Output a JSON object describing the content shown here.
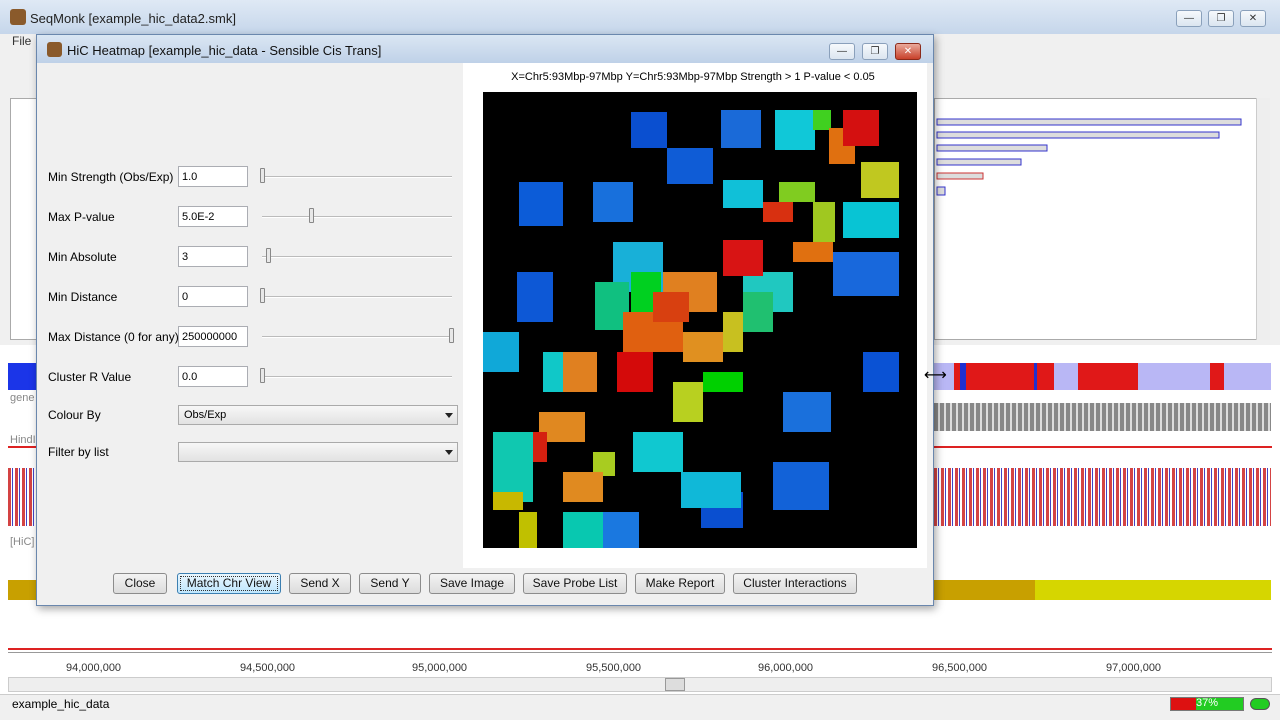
{
  "main_window": {
    "title": "SeqMonk [example_hic_data2.smk]",
    "menu_file": "File",
    "controls": {
      "minimize": "—",
      "maximize": "❐",
      "close": "✕"
    }
  },
  "background": {
    "track_labels": [
      "gene",
      "HindI",
      "[HiC]"
    ],
    "axis_labels": [
      "94,000,000",
      "94,500,000",
      "95,000,000",
      "95,500,000",
      "96,000,000",
      "96,500,000",
      "97,000,000"
    ],
    "status_text": "example_hic_data",
    "memory_text": "37%"
  },
  "dialog": {
    "title": "HiC Heatmap [example_hic_data - Sensible Cis Trans]",
    "controls": {
      "minimize": "—",
      "maximize": "❐",
      "close": "✕"
    },
    "fields": [
      {
        "label": "Min Strength (Obs/Exp)",
        "value": "1.0",
        "slider": 0.0
      },
      {
        "label": "Max P-value",
        "value": "5.0E-2",
        "slider": 0.26
      },
      {
        "label": "Min Absolute",
        "value": "3",
        "slider": 0.03
      },
      {
        "label": "Min Distance",
        "value": "0",
        "slider": 0.0
      },
      {
        "label": "Max Distance (0 for any)",
        "value": "250000000",
        "slider": 1.0
      },
      {
        "label": "Cluster R Value",
        "value": "0.0",
        "slider": 0.0
      }
    ],
    "colour_by": {
      "label": "Colour By",
      "value": "Obs/Exp"
    },
    "filter_by": {
      "label": "Filter by list",
      "value": ""
    },
    "plot_title": "X=Chr5:93Mbp-97Mbp Y=Chr5:93Mbp-97Mbp Strength > 1 P-value < 0.05",
    "buttons": [
      "Close",
      "Match Chr View",
      "Send X",
      "Send Y",
      "Save Image",
      "Save Probe List",
      "Make Report",
      "Cluster Interactions"
    ]
  },
  "colors": {
    "heatmap_background": "#000000",
    "dialog_border": "#6a87ad",
    "focused_button": "#3c7fb1"
  }
}
